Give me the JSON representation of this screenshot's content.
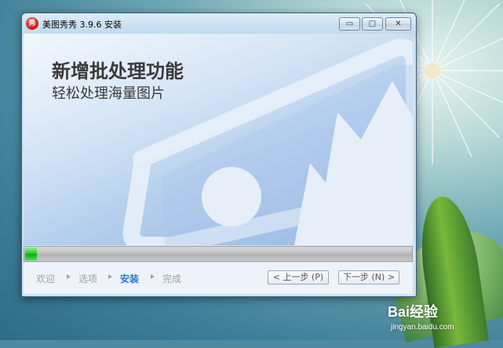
{
  "window": {
    "title": "美图秀秀 3.9.6  安装",
    "app_icon_glyph": "秀",
    "controls": {
      "minimize": "▭",
      "maximize": "□",
      "close": "✕"
    }
  },
  "banner": {
    "headline": "新增批处理功能",
    "subline": "轻松处理海量图片",
    "illustration": "photo-frame-icon"
  },
  "progress": {
    "value_percent": 3,
    "color": "#22c322"
  },
  "steps": [
    {
      "label": "欢迎",
      "active": false
    },
    {
      "label": "选项",
      "active": false
    },
    {
      "label": "安装",
      "active": true
    },
    {
      "label": "完成",
      "active": false
    }
  ],
  "buttons": {
    "back": "< 上一步 (P)",
    "next": "下一步 (N) >"
  },
  "watermark": {
    "brand": "Bai经验",
    "url": "jingyan.baidu.com"
  },
  "colors": {
    "accent": "#3177c8",
    "titlebar": "#bcd7ee",
    "progress_track": "#bdbdbd"
  }
}
